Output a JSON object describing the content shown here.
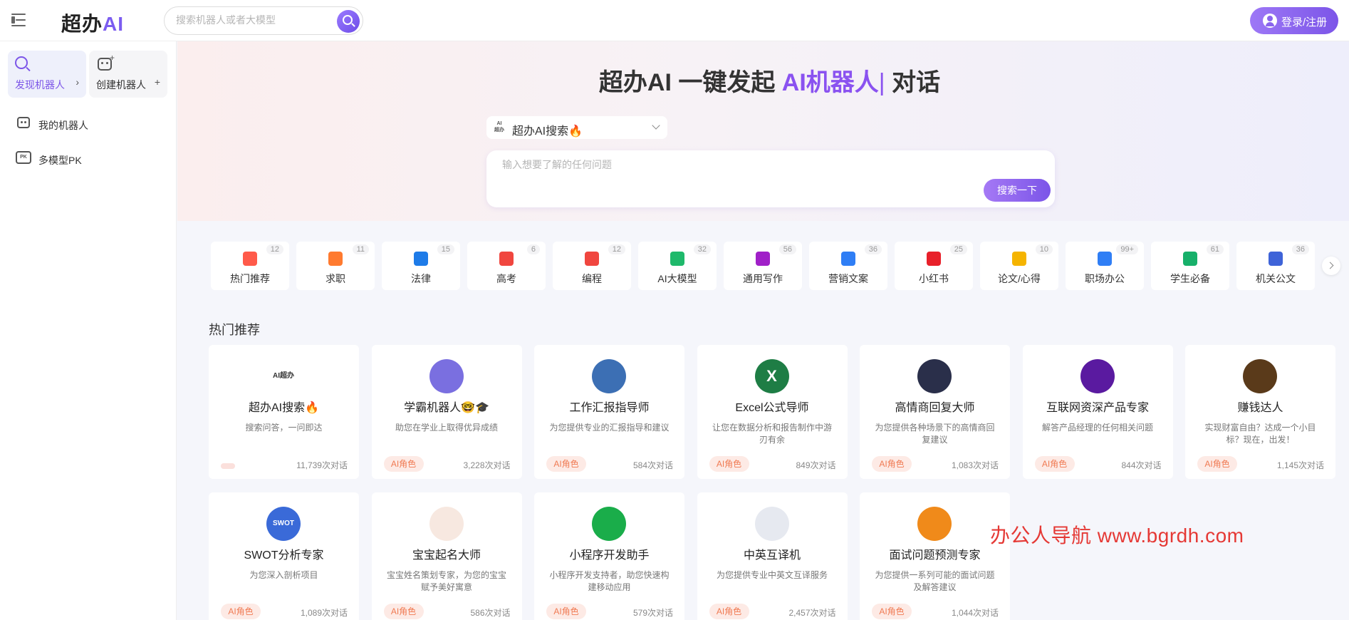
{
  "header": {
    "logo_text": "超办",
    "logo_ai": "AI",
    "search_placeholder": "搜索机器人或者大模型",
    "login_label": "登录/注册"
  },
  "sidebar": {
    "discover_label": "发现机器人",
    "create_label": "创建机器人",
    "items": [
      {
        "label": "我的机器人"
      },
      {
        "label": "多模型PK"
      }
    ]
  },
  "hero": {
    "title_prefix": "超办AI 一键发起 ",
    "title_highlight": "AI机器人",
    "title_caret": "|",
    "title_suffix": " 对话",
    "model_label": "超办AI搜索🔥",
    "query_placeholder": "输入想要了解的任何问题",
    "query_button": "搜索一下"
  },
  "categories": [
    {
      "label": "热门推荐",
      "count": "12",
      "color": "#ff5a4a"
    },
    {
      "label": "求职",
      "count": "11",
      "color": "#ff7a2f"
    },
    {
      "label": "法律",
      "count": "15",
      "color": "#1e7be8"
    },
    {
      "label": "高考",
      "count": "6",
      "color": "#f0463f"
    },
    {
      "label": "编程",
      "count": "12",
      "color": "#f0463f"
    },
    {
      "label": "AI大模型",
      "count": "32",
      "color": "#1fb96b"
    },
    {
      "label": "通用写作",
      "count": "56",
      "color": "#a020c8"
    },
    {
      "label": "营销文案",
      "count": "36",
      "color": "#2f7ef5"
    },
    {
      "label": "小红书",
      "count": "25",
      "color": "#e8202a"
    },
    {
      "label": "论文/心得",
      "count": "10",
      "color": "#f5b400"
    },
    {
      "label": "职场办公",
      "count": "99+",
      "color": "#2f7ef5"
    },
    {
      "label": "学生必备",
      "count": "61",
      "color": "#17b06a"
    },
    {
      "label": "机关公文",
      "count": "36",
      "color": "#3e63d8"
    }
  ],
  "section_title": "热门推荐",
  "bots": [
    {
      "name": "超办AI搜索🔥",
      "desc": "搜索问答，一问即达",
      "tag": "",
      "stat": "11,739次对话",
      "avatar_color": "#ffffff",
      "avatar_text": "AI超办"
    },
    {
      "name": "学霸机器人🤓🎓",
      "desc": "助您在学业上取得优异成绩",
      "tag": "AI角色",
      "stat": "3,228次对话",
      "avatar_color": "#7a6fe0",
      "avatar_text": ""
    },
    {
      "name": "工作汇报指导师",
      "desc": "为您提供专业的汇报指导和建议",
      "tag": "AI角色",
      "stat": "584次对话",
      "avatar_color": "#3c6fb4",
      "avatar_text": ""
    },
    {
      "name": "Excel公式导师",
      "desc": "让您在数据分析和报告制作中游刃有余",
      "tag": "AI角色",
      "stat": "849次对话",
      "avatar_color": "#1e7d45",
      "avatar_text": "X"
    },
    {
      "name": "高情商回复大师",
      "desc": "为您提供各种场景下的高情商回复建议",
      "tag": "AI角色",
      "stat": "1,083次对话",
      "avatar_color": "#2a2f4a",
      "avatar_text": ""
    },
    {
      "name": "互联网资深产品专家",
      "desc": "解答产品经理的任何相关问题",
      "tag": "AI角色",
      "stat": "844次对话",
      "avatar_color": "#5a1aa0",
      "avatar_text": ""
    },
    {
      "name": "赚钱达人",
      "desc": "实现财富自由？达成一个小目标？现在，出发！",
      "tag": "AI角色",
      "stat": "1,145次对话",
      "avatar_color": "#5a3a1a",
      "avatar_text": ""
    },
    {
      "name": "SWOT分析专家",
      "desc": "为您深入剖析项目",
      "tag": "AI角色",
      "stat": "1,089次对话",
      "avatar_color": "#3a6ad8",
      "avatar_text": "SWOT"
    },
    {
      "name": "宝宝起名大师",
      "desc": "宝宝姓名策划专家，为您的宝宝赋予美好寓意",
      "tag": "AI角色",
      "stat": "586次对话",
      "avatar_color": "#f7e8e0",
      "avatar_text": ""
    },
    {
      "name": "小程序开发助手",
      "desc": "小程序开发支持者，助您快速构建移动应用",
      "tag": "AI角色",
      "stat": "579次对话",
      "avatar_color": "#1aad4a",
      "avatar_text": ""
    },
    {
      "name": "中英互译机",
      "desc": "为您提供专业中英文互译服务",
      "tag": "AI角色",
      "stat": "2,457次对话",
      "avatar_color": "#e6e9f0",
      "avatar_text": ""
    },
    {
      "name": "面试问题预测专家",
      "desc": "为您提供一系列可能的面试问题及解答建议",
      "tag": "AI角色",
      "stat": "1,044次对话",
      "avatar_color": "#f08a1a",
      "avatar_text": ""
    }
  ],
  "watermark": "办公人导航 www.bgrdh.com"
}
